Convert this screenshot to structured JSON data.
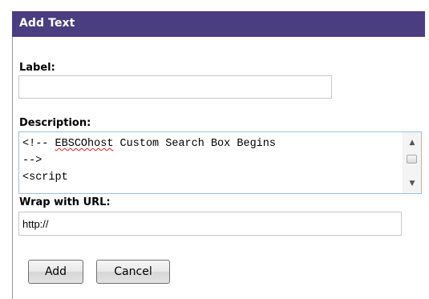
{
  "dialog": {
    "title": "Add Text"
  },
  "form": {
    "label_caption": "Label:",
    "label_value": "",
    "description_caption": "Description:",
    "description_lines": [
      {
        "before": "<!-- ",
        "misspelled": "EBSCOhost",
        "after": " Custom Search Box Begins"
      },
      {
        "before": "-->",
        "misspelled": "",
        "after": ""
      },
      {
        "before": "<script",
        "misspelled": "",
        "after": ""
      }
    ],
    "wrap_url_caption": "Wrap with URL:",
    "wrap_url_value": "http://"
  },
  "buttons": {
    "add_label": "Add",
    "cancel_label": "Cancel"
  },
  "icons": {
    "scroll_up": "scroll-up-arrow-icon",
    "scroll_down": "scroll-down-arrow-icon"
  },
  "colors": {
    "titlebar": "#4a3d80",
    "spellcheck_underline": "#e02020",
    "textarea_border": "#9cc0de"
  }
}
